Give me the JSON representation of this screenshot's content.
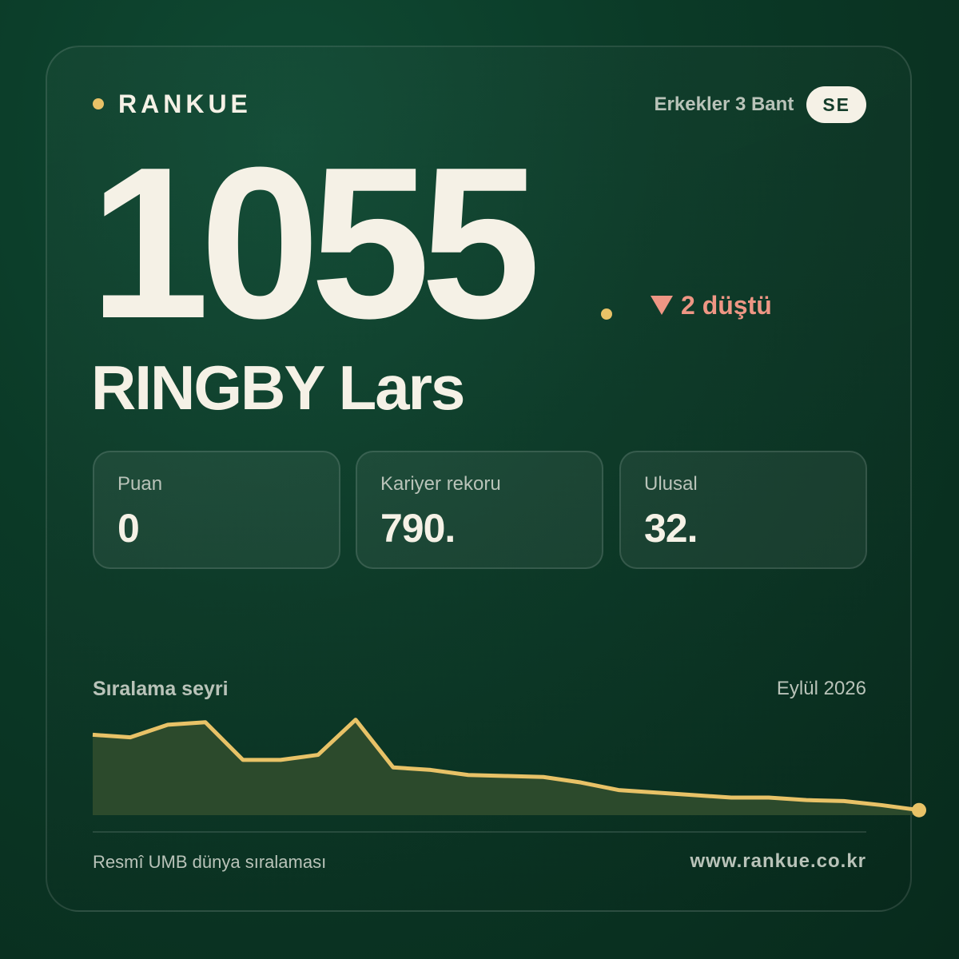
{
  "brand": {
    "name": "RANKUE"
  },
  "category": {
    "label": "Erkekler 3 Bant",
    "country_code": "SE"
  },
  "rank": {
    "value": "1055",
    "change_text": "2 düştü",
    "change_direction": "down"
  },
  "player": {
    "name": "RINGBY Lars"
  },
  "stats": [
    {
      "label": "Puan",
      "value": "0"
    },
    {
      "label": "Kariyer rekoru",
      "value": "790."
    },
    {
      "label": "Ulusal",
      "value": "32."
    }
  ],
  "trend": {
    "title": "Sıralama seyri",
    "date": "Eylül 2026"
  },
  "chart_data": {
    "type": "area",
    "series": [
      {
        "values": [
          50,
          50.5,
          48,
          47.5,
          55,
          55,
          54,
          47,
          56.5,
          57,
          58,
          58.2,
          58.4,
          59.5,
          61,
          61.5,
          62,
          62.5,
          62.5,
          63,
          63.2,
          64,
          65
        ]
      }
    ],
    "ylim": [
      45,
      66
    ],
    "colors": {
      "line": "#e8c267",
      "fill": "#2c4a2c"
    }
  },
  "footer": {
    "left_text": "Resmî UMB dünya sıralaması",
    "right_text": "www.rankue.co.kr"
  },
  "colors": {
    "accent": "#e8c267",
    "down": "#ee9684",
    "text": "#f5f1e6",
    "muted": "#b9c3b9"
  }
}
